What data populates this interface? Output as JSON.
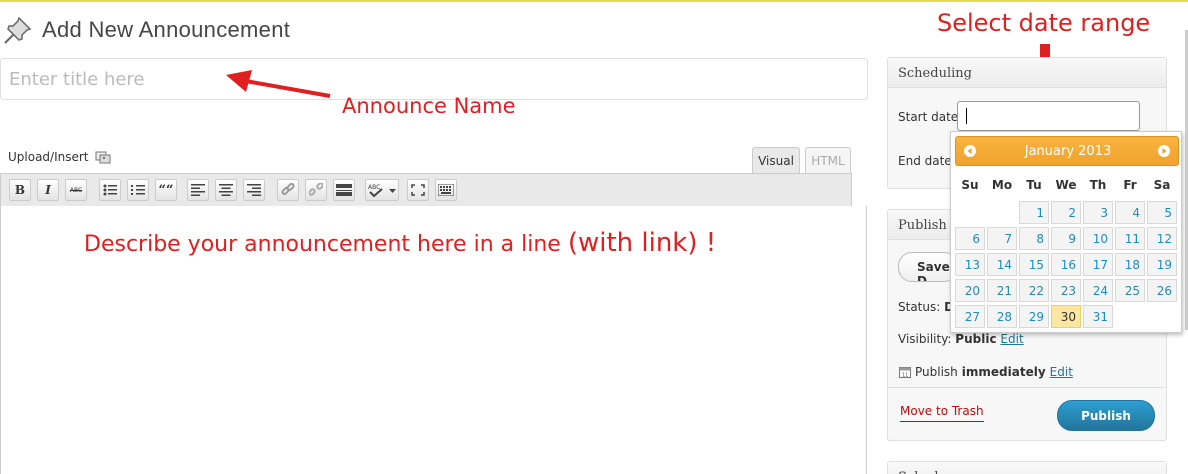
{
  "header": {
    "title": "Add New Announcement"
  },
  "title_field": {
    "placeholder": "Enter title here"
  },
  "annotations": {
    "announce_name": "Announce Name",
    "select_date_range": "Select date range",
    "describe_prefix": "Describe your announcement here in a line ",
    "describe_suffix": "(with link) !"
  },
  "editor": {
    "upload_label": "Upload/Insert",
    "tabs": {
      "visual": "Visual",
      "html": "HTML"
    },
    "toolbar": {
      "bold": "B",
      "italic": "I",
      "abc": "ABC",
      "quote": "““",
      "spell": "ABC"
    }
  },
  "scheduling": {
    "heading": "Scheduling",
    "start_label": "Start date",
    "end_label": "End date"
  },
  "datepicker": {
    "month_title": "January 2013",
    "weekdays": [
      "Su",
      "Mo",
      "Tu",
      "We",
      "Th",
      "Fr",
      "Sa"
    ],
    "days": [
      "1",
      "2",
      "3",
      "4",
      "5",
      "6",
      "7",
      "8",
      "9",
      "10",
      "11",
      "12",
      "13",
      "14",
      "15",
      "16",
      "17",
      "18",
      "19",
      "20",
      "21",
      "22",
      "23",
      "24",
      "25",
      "26",
      "27",
      "28",
      "29",
      "30",
      "31"
    ],
    "first_weekday_index": 2,
    "selected_day": "30"
  },
  "publish": {
    "heading": "Publish",
    "save_label": "Save D",
    "status_label": "Status:",
    "status_value": "D",
    "visibility_label": "Visibility:",
    "visibility_value": "Public",
    "visibility_edit": "Edit",
    "publish_prefix": "Publish",
    "publish_value": "immediately",
    "publish_edit": "Edit",
    "trash_label": "Move to Trash",
    "publish_button": "Publish"
  },
  "bottom_box": {
    "heading": "Schedu"
  },
  "colors": {
    "annotation_red": "#e02020",
    "link_blue": "#21759b",
    "datepicker_orange": "#f0a22e",
    "today_yellow": "#fbe6a2"
  }
}
